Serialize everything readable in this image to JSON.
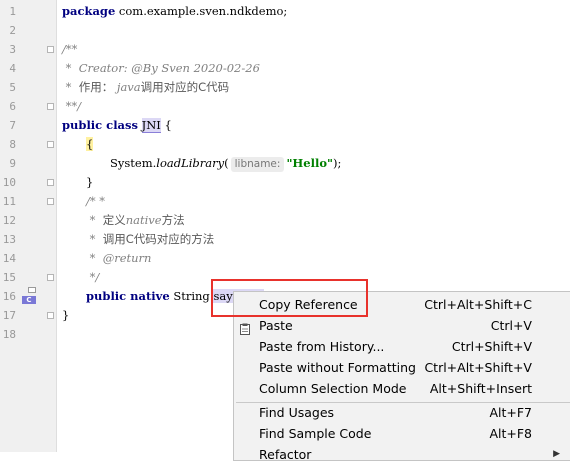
{
  "gutter": {
    "line_numbers": [
      "1",
      "2",
      "3",
      "4",
      "5",
      "6",
      "7",
      "8",
      "9",
      "10",
      "11",
      "12",
      "13",
      "14",
      "15",
      "16",
      "17",
      "18"
    ],
    "method_marker_label": "C"
  },
  "code": {
    "l1_kw": "package",
    "l1_rest": " com.example.sven.ndkdemo;",
    "l3": "/**",
    "l4": " *  Creator: @By Sven 2020-02-26",
    "l5_a": " *  ",
    "l5_cn1": "作用：",
    "l5_en": " java",
    "l5_cn2": "调用对应的C代码",
    "l6": " **/",
    "l7_kw": "public class",
    "l7_sp": " ",
    "l7_cls": "JNI",
    "l7_brace": " {",
    "l8": "{",
    "l9_sys": "System.",
    "l9_method": "loadLibrary",
    "l9_paren_open": "(",
    "l9_hint": "libname:",
    "l9_str": "\"Hello\"",
    "l9_close": ");",
    "l10": "}",
    "l11": "/* *",
    "l12_star": " *  ",
    "l12_cn1": "定义",
    "l12_en": "native",
    "l12_cn2": "方法",
    "l13_star": " *  ",
    "l13_cn": "调用C代码对应的方法",
    "l14_star": " *  ",
    "l14_tag": "@return",
    "l15": " */",
    "l16_kw": "public native",
    "l16_type": " String ",
    "l16_sel": "sayHello",
    "l16_rest": "();",
    "l17": "}"
  },
  "context_menu": {
    "items": [
      {
        "label": "Copy Reference",
        "shortcut": "Ctrl+Alt+Shift+C"
      },
      {
        "label": "Paste",
        "shortcut": "Ctrl+V",
        "icon": "clipboard-icon"
      },
      {
        "label": "Paste from History...",
        "shortcut": "Ctrl+Shift+V"
      },
      {
        "label": "Paste without Formatting",
        "shortcut": "Ctrl+Alt+Shift+V"
      },
      {
        "label": "Column Selection Mode",
        "shortcut": "Alt+Shift+Insert"
      },
      {
        "label": "Find Usages",
        "shortcut": "Alt+F7"
      },
      {
        "label": "Find Sample Code",
        "shortcut": "Alt+F8"
      },
      {
        "label": "Refactor",
        "shortcut": "",
        "submenu": true
      }
    ]
  },
  "colors": {
    "keyword": "#000080",
    "string": "#008000",
    "comment": "#808080",
    "callout": "#e8322c",
    "identifier_highlight": "#dcd8f5"
  }
}
